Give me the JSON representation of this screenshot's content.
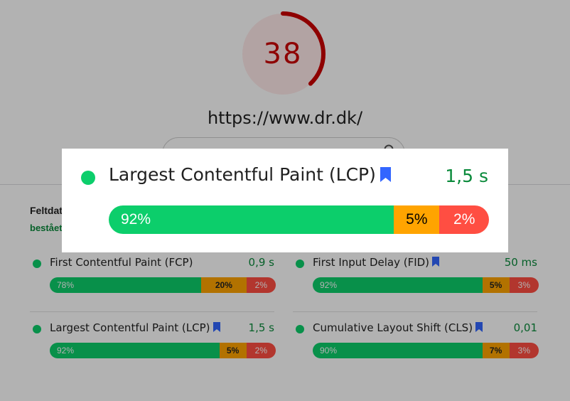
{
  "report": {
    "score": "38",
    "score_fraction": 0.38,
    "url": "https://www.dr.dk/",
    "search_placeholder": ""
  },
  "field_data": {
    "title": "Feltdat",
    "subtitle": "bestået"
  },
  "metrics": [
    {
      "name": "First Contentful Paint (FCP)",
      "bookmark": false,
      "value": "0,9 s",
      "good": "78%",
      "good_pct": 78,
      "avg": "20%",
      "avg_pct": 20,
      "poor": "2%",
      "poor_pct": 2
    },
    {
      "name": "First Input Delay (FID)",
      "bookmark": true,
      "value": "50 ms",
      "good": "92%",
      "good_pct": 92,
      "avg": "5%",
      "avg_pct": 5,
      "poor": "3%",
      "poor_pct": 3
    },
    {
      "name": "Largest Contentful Paint (LCP)",
      "bookmark": true,
      "value": "1,5 s",
      "good": "92%",
      "good_pct": 92,
      "avg": "5%",
      "avg_pct": 5,
      "poor": "2%",
      "poor_pct": 2
    },
    {
      "name": "Cumulative Layout Shift (CLS)",
      "bookmark": true,
      "value": "0,01",
      "good": "90%",
      "good_pct": 90,
      "avg": "7%",
      "avg_pct": 7,
      "poor": "3%",
      "poor_pct": 3
    }
  ],
  "popup": {
    "name": "Largest Contentful Paint (LCP)",
    "value": "1,5 s",
    "good": "92%",
    "good_pct": 75,
    "avg": "5%",
    "avg_pct": 12,
    "poor": "2%",
    "poor_pct": 13
  },
  "colors": {
    "good": "#0cce6b",
    "average": "#ffa400",
    "poor": "#ff4e42",
    "score_red": "#cc0000",
    "bookmark_blue": "#3366ff"
  },
  "icons": {
    "bookmark": "bookmark-icon",
    "status": "green-circle-icon",
    "search": "search-icon"
  }
}
